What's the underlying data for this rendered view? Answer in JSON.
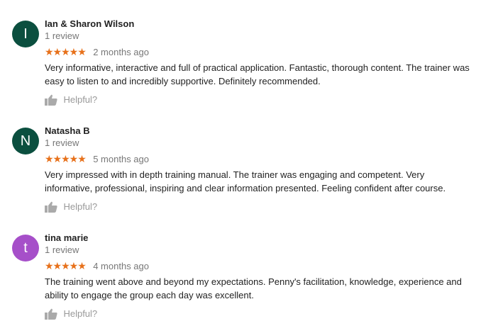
{
  "reviews": [
    {
      "avatar_letter": "I",
      "avatar_color": "#0b4f3f",
      "name": "Ian & Sharon Wilson",
      "review_count": "1 review",
      "stars": "★★★★★",
      "date": "2 months ago",
      "text": "Very informative, interactive and full of practical application. Fantastic, thorough content. The trainer was easy to listen to and incredibly supportive. Definitely recommended.",
      "helpful_label": "Helpful?"
    },
    {
      "avatar_letter": "N",
      "avatar_color": "#0b4f3f",
      "name": "Natasha B",
      "review_count": "1 review",
      "stars": "★★★★★",
      "date": "5 months ago",
      "text": "Very impressed with in depth training manual. The trainer was engaging and competent. Very informative, professional, inspiring and clear information presented. Feeling confident after course.",
      "helpful_label": "Helpful?"
    },
    {
      "avatar_letter": "t",
      "avatar_color": "#a64fc9",
      "name": "tina marie",
      "review_count": "1 review",
      "stars": "★★★★★",
      "date": "4 months ago",
      "text": "The training went above and beyond my expectations. Penny's facilitation, knowledge, experience and ability to engage the group each day was excellent.",
      "helpful_label": "Helpful?"
    }
  ],
  "colors": {
    "star": "#e7711b",
    "muted_text": "#777777",
    "helpful_text": "#999999",
    "thumb_icon": "#aaaaaa"
  },
  "icons": {
    "thumb": "thumbs-up-icon"
  }
}
